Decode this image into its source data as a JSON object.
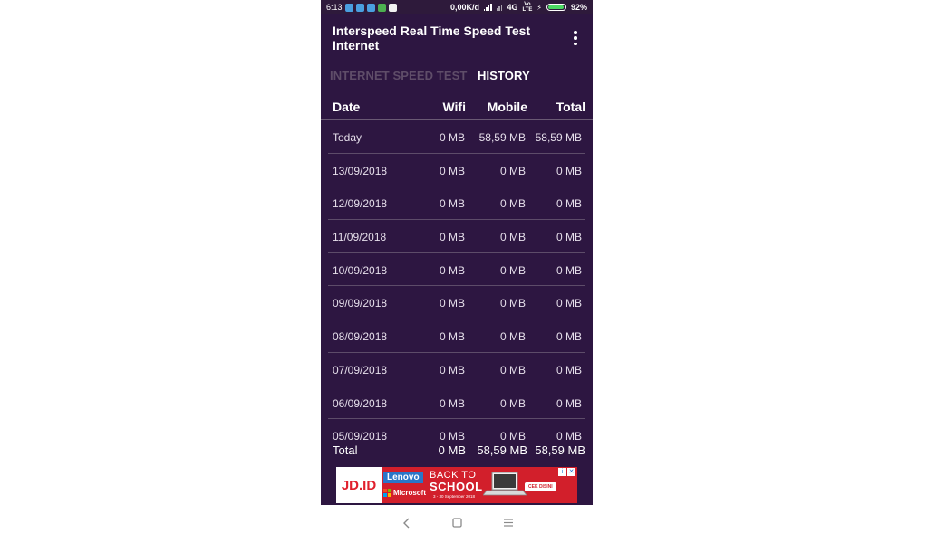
{
  "status_bar": {
    "time": "6:13",
    "network_speed": "0,00K/d",
    "network_type": "4G",
    "volte_label_top": "Vo",
    "volte_label_bottom": "LTE",
    "battery": "92%",
    "battery_level": 0.92,
    "notification_colors": [
      "#4a9fe0",
      "#4a9fe0",
      "#4a9fe0",
      "#4caf50",
      "#f2f2f2"
    ]
  },
  "app": {
    "title": "Interspeed Real Time Speed Test Internet",
    "menu_icon": "overflow-menu-icon",
    "colors": {
      "background": "#2d1641",
      "status_bar": "#2e1a3b"
    }
  },
  "tabs": [
    {
      "label": "INTERNET SPEED TEST",
      "active": false
    },
    {
      "label": "HISTORY",
      "active": true
    }
  ],
  "table": {
    "headers": {
      "date": "Date",
      "wifi": "Wifi",
      "mobile": "Mobile",
      "total": "Total"
    },
    "rows": [
      {
        "date": "Today",
        "wifi": "0 MB",
        "mobile": "58,59 MB",
        "total": "58,59 MB"
      },
      {
        "date": "13/09/2018",
        "wifi": "0 MB",
        "mobile": "0 MB",
        "total": "0 MB"
      },
      {
        "date": "12/09/2018",
        "wifi": "0 MB",
        "mobile": "0 MB",
        "total": "0 MB"
      },
      {
        "date": "11/09/2018",
        "wifi": "0 MB",
        "mobile": "0 MB",
        "total": "0 MB"
      },
      {
        "date": "10/09/2018",
        "wifi": "0 MB",
        "mobile": "0 MB",
        "total": "0 MB"
      },
      {
        "date": "09/09/2018",
        "wifi": "0 MB",
        "mobile": "0 MB",
        "total": "0 MB"
      },
      {
        "date": "08/09/2018",
        "wifi": "0 MB",
        "mobile": "0 MB",
        "total": "0 MB"
      },
      {
        "date": "07/09/2018",
        "wifi": "0 MB",
        "mobile": "0 MB",
        "total": "0 MB"
      },
      {
        "date": "06/09/2018",
        "wifi": "0 MB",
        "mobile": "0 MB",
        "total": "0 MB"
      },
      {
        "date": "05/09/2018",
        "wifi": "0 MB",
        "mobile": "0 MB",
        "total": "0 MB"
      }
    ],
    "totals": {
      "label": "Total",
      "wifi": "0 MB",
      "mobile": "58,59 MB",
      "total": "58,59 MB"
    }
  },
  "ad": {
    "advertiser": "JD.ID",
    "brand": "Lenovo",
    "partner": "Microsoft",
    "headline_top": "BACK TO",
    "headline_bottom": "SCHOOL",
    "date_range": "3 - 30 September 2018",
    "cta": "CEK DISINI",
    "info_icon": "info-icon",
    "close_icon": "close-icon",
    "colors": {
      "red": "#d21f2b",
      "blue": "#2a76c8"
    }
  },
  "nav_bar": {
    "icons": [
      "back-icon",
      "home-icon",
      "menu-icon"
    ]
  }
}
